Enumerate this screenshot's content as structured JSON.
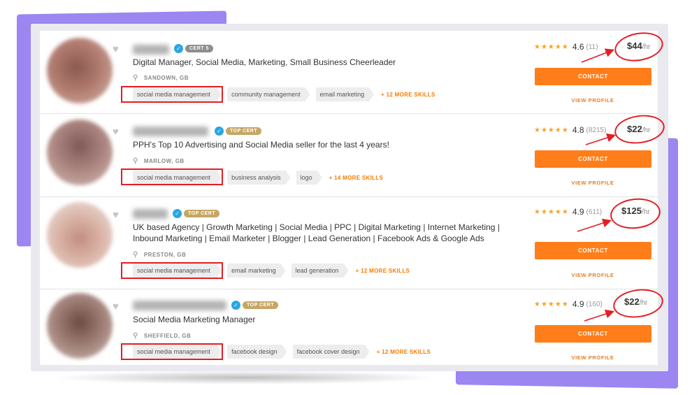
{
  "colors": {
    "accent": "#ff7e1a",
    "highlight": "#e31e24",
    "star": "#f5a623",
    "decor": "#9b86f2"
  },
  "freelancers": [
    {
      "badge": "CERT 5",
      "badge_type": "cert",
      "title": "Digital Manager, Social Media, Marketing, Small Business Cheerleader",
      "location": "SANDOWN, GB",
      "skills": [
        "social media management",
        "community management",
        "email marketing"
      ],
      "more_skills": "+ 12 MORE SKILLS",
      "stars": "★★★★★",
      "rating": "4.6",
      "reviews": "(11)",
      "price": "$44",
      "per": "/hr",
      "contact": "CONTACT",
      "view_profile": "VIEW PROFILE",
      "avatar_color": "#b07a6e"
    },
    {
      "badge": "TOP CERT",
      "badge_type": "top",
      "title": "PPH's Top 10 Advertising and Social Media seller for the last 4 years!",
      "location": "MARLOW, GB",
      "skills": [
        "social media management",
        "business analysis",
        "logo"
      ],
      "more_skills": "+ 14 MORE SKILLS",
      "stars": "★★★★★",
      "rating": "4.8",
      "reviews": "(8215)",
      "price": "$22",
      "per": "/hr",
      "contact": "CONTACT",
      "view_profile": "VIEW PROFILE",
      "avatar_color": "#a9837e"
    },
    {
      "badge": "TOP CERT",
      "badge_type": "top",
      "title": "UK based Agency | Growth Marketing | Social Media | PPC | Digital Marketing | Internet Marketing | Inbound Marketing | Email Marketer | Blogger | Lead Generation | Facebook Ads & Google Ads",
      "location": "PRESTON, GB",
      "skills": [
        "social media management",
        "email marketing",
        "lead generation"
      ],
      "more_skills": "+ 12 MORE SKILLS",
      "stars": "★★★★★",
      "rating": "4.9",
      "reviews": "(611)",
      "price": "$125",
      "per": "/hr",
      "contact": "CONTACT",
      "view_profile": "VIEW PROFILE",
      "avatar_color": "#d8b0a2"
    },
    {
      "badge": "TOP CERT",
      "badge_type": "top",
      "title": "Social Media Marketing Manager",
      "location": "SHEFFIELD, GB",
      "skills": [
        "social media management",
        "facebook design",
        "facebook cover design"
      ],
      "more_skills": "+ 12 MORE SKILLS",
      "stars": "★★★★★",
      "rating": "4.9",
      "reviews": "(160)",
      "price": "$22",
      "per": "/hr",
      "contact": "CONTACT",
      "view_profile": "VIEW PROFILE",
      "avatar_color": "#9c7b72"
    }
  ]
}
